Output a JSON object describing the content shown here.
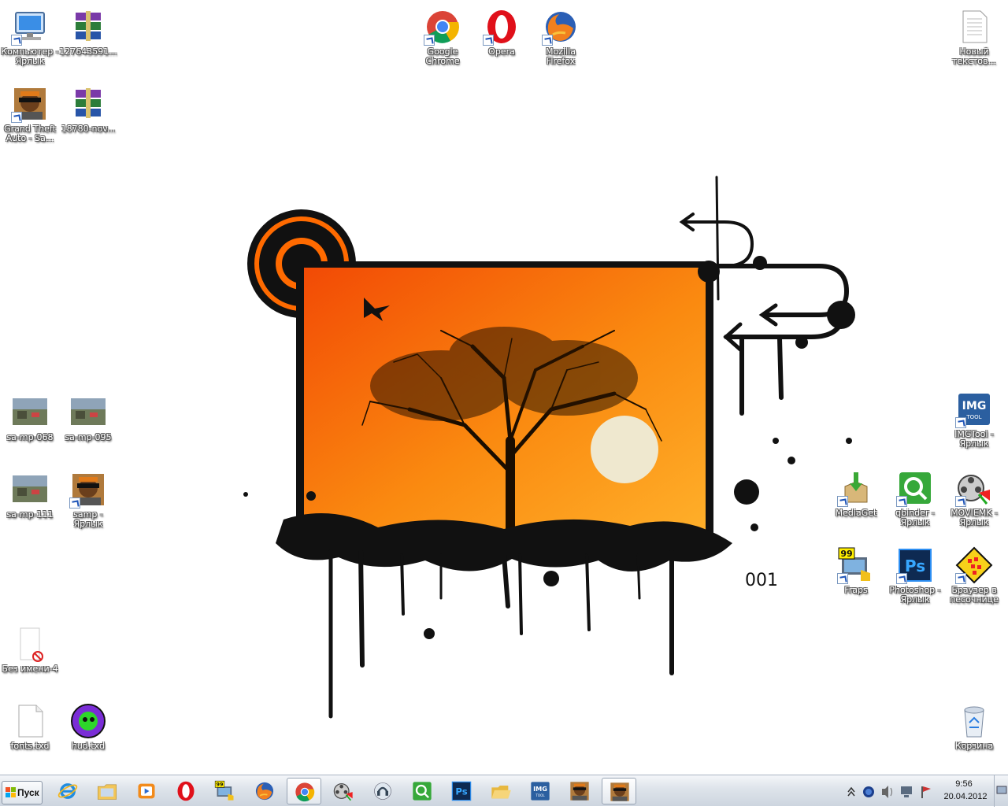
{
  "desktop": {
    "icons": [
      {
        "id": "computer",
        "label": "Компьютер - Ярлык",
        "icon": "computer-icon",
        "shortcut": true
      },
      {
        "id": "rar1",
        "label": "127643591...",
        "icon": "winrar-archive-icon",
        "shortcut": false
      },
      {
        "id": "chrome",
        "label": "Google Chrome",
        "icon": "chrome-icon",
        "shortcut": true
      },
      {
        "id": "opera",
        "label": "Opera",
        "icon": "opera-icon",
        "shortcut": true
      },
      {
        "id": "firefox",
        "label": "Mozilla Firefox",
        "icon": "firefox-icon",
        "shortcut": true
      },
      {
        "id": "newtext",
        "label": "Новый текстов...",
        "icon": "text-file-icon",
        "shortcut": false
      },
      {
        "id": "gta",
        "label": "Grand Theft Auto - Sa...",
        "icon": "gta-sa-icon",
        "shortcut": true
      },
      {
        "id": "rar2",
        "label": "18780-nov...",
        "icon": "winrar-archive-icon",
        "shortcut": false
      },
      {
        "id": "samp068",
        "label": "sa-mp-068",
        "icon": "screenshot-thumbnail-icon",
        "shortcut": false
      },
      {
        "id": "samp095",
        "label": "sa-mp-095",
        "icon": "screenshot-thumbnail-icon",
        "shortcut": false
      },
      {
        "id": "imgtool",
        "label": "IMGTool - Ярлык",
        "icon": "imgtool-icon",
        "shortcut": true
      },
      {
        "id": "samp111",
        "label": "sa-mp-111",
        "icon": "screenshot-thumbnail-icon",
        "shortcut": false
      },
      {
        "id": "samp",
        "label": "samp - Ярлык",
        "icon": "samp-icon",
        "shortcut": true
      },
      {
        "id": "mediaget",
        "label": "MediaGet",
        "icon": "mediaget-icon",
        "shortcut": true
      },
      {
        "id": "qbinder",
        "label": "qbinder - Ярлык",
        "icon": "qbinder-icon",
        "shortcut": true
      },
      {
        "id": "moviemk",
        "label": "MOVIEMK - Ярлык",
        "icon": "movie-maker-icon",
        "shortcut": true
      },
      {
        "id": "fraps",
        "label": "Fraps",
        "icon": "fraps-icon",
        "shortcut": true
      },
      {
        "id": "photoshop",
        "label": "Photoshop - Ярлык",
        "icon": "photoshop-icon",
        "shortcut": true
      },
      {
        "id": "sandbox",
        "label": "Браузер в песочнице",
        "icon": "sandboxie-icon",
        "shortcut": true
      },
      {
        "id": "bezimeni",
        "label": "Без имени-4",
        "icon": "image-file-icon",
        "shortcut": false
      },
      {
        "id": "fonts",
        "label": "fonts.txd",
        "icon": "blank-file-icon",
        "shortcut": false
      },
      {
        "id": "hud",
        "label": "hud.txd",
        "icon": "hud-txd-icon",
        "shortcut": false
      },
      {
        "id": "recycle",
        "label": "Корзина",
        "icon": "recycle-bin-icon",
        "shortcut": false
      }
    ],
    "wallpaper_text": "001"
  },
  "taskbar": {
    "start_label": "Пуск",
    "pinned": [
      {
        "name": "internet-explorer-icon",
        "active": false
      },
      {
        "name": "explorer-folder-icon",
        "active": false
      },
      {
        "name": "media-player-icon",
        "active": false
      },
      {
        "name": "opera-icon",
        "active": false
      },
      {
        "name": "fraps-icon",
        "active": false
      },
      {
        "name": "firefox-icon",
        "active": false
      },
      {
        "name": "chrome-icon",
        "active": true
      },
      {
        "name": "movie-maker-icon",
        "active": false
      },
      {
        "name": "teamspeak-icon",
        "active": false
      },
      {
        "name": "qbinder-icon",
        "active": false
      },
      {
        "name": "photoshop-icon",
        "active": false
      },
      {
        "name": "folder-open-icon",
        "active": false
      },
      {
        "name": "imgtool-icon",
        "active": false
      },
      {
        "name": "samp-icon",
        "active": false
      },
      {
        "name": "gta-sa-icon",
        "active": true
      }
    ],
    "tray": {
      "time": "9:56",
      "date": "20.04.2012"
    }
  },
  "colors": {
    "accent_orange": "#f26a0c",
    "wallpaper_bg": "#ffffff",
    "taskbar_bg": "#dde3ea"
  }
}
